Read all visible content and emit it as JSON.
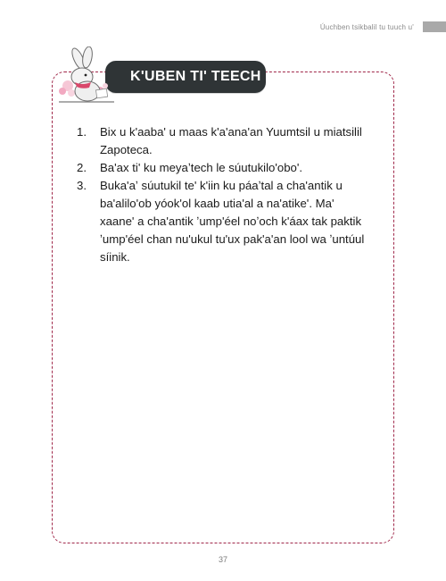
{
  "running_header": "Úuchben tsikbalil tu tuuch u'",
  "title": "K'UBEN TI' TEECH",
  "instructions": [
    {
      "num": "1.",
      "text": "Bix u k'aaba' u maas k'a'ana'an Yuumtsil u miatsilil Zapoteca."
    },
    {
      "num": "2.",
      "text": "Ba'ax ti' ku meyaʼtech le súutukilo'obo'."
    },
    {
      "num": "3.",
      "text": "Buka'aʼ súutukil te' k'iin ku páaʼtal a cha'antik u ba'alilo'ob yóok'ol kaab utia'al a na'atike'. Ma' xaane' a cha'antik ʼump'éel noʼoch k'áax tak paktik ʼump'éel chan nu'ukul tu'ux pak'a'an lool wa ʼuntúul síinik."
    }
  ],
  "page_number": "37",
  "colors": {
    "accent": "#a0284a",
    "tab": "#2f3436"
  },
  "icons": {
    "illustration": "rabbit-writing-icon"
  }
}
